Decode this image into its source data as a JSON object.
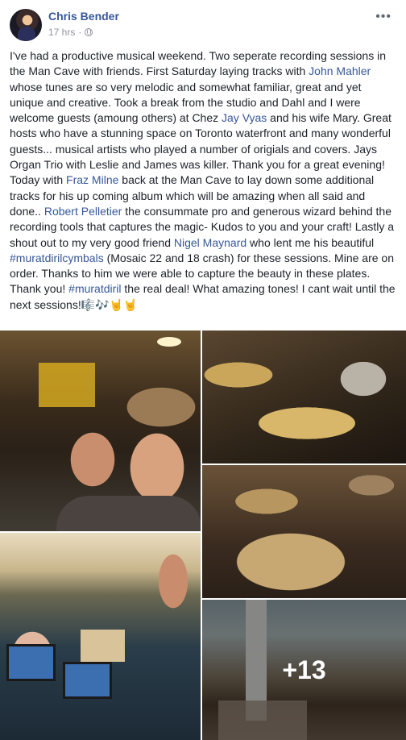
{
  "post": {
    "author": "Chris Bender",
    "time": "17 hrs",
    "separator": "·",
    "privacy_icon": "globe-icon",
    "more_icon": "ellipsis-icon",
    "body": {
      "t1": "I've had a productive musical weekend. Two seperate recording sessions in the Man Cave with friends. First Saturday laying tracks with ",
      "link_john": "John Mahler",
      "t2": " whose tunes are so very melodic and somewhat familiar, great and yet unique and creative. Took a break from the studio and Dahl and I were welcome guests (amoung others) at Chez ",
      "link_jay": "Jay Vyas",
      "t3": " and his wife Mary. Great hosts who have a stunning space on Toronto waterfront and many wonderful guests... musical artists who played a number of origials and covers. Jays Organ Trio with Leslie and James was killer. Thank you for a great evening! Today with ",
      "link_fraz": "Fraz Milne",
      "t4": " back at the Man Cave to lay down some additional tracks for his up coming album which will be amazing when all said and done.. ",
      "link_robert": "Robert Pelletier",
      "t5": " the consummate pro and generous wizard behind the recording tools that captures the magic- Kudos to you and your craft! Lastly a shout out to my very good friend ",
      "link_nigel": "Nigel Maynard",
      "t6": " who lent me his beautiful ",
      "hashtag_cymbals": "#muratdirilcymbals",
      "t7": " (Mosaic 22 and 18 crash) for these sessions. Mine are on order. Thanks to him we were able to capture the beauty in these plates. Thank you! ",
      "hashtag_diril": "#muratdiril",
      "t8": " the real deal! What amazing tones! I cant wait until the next sessions!🎼🎶🤘🤘"
    },
    "photos_more_count": "+13"
  }
}
